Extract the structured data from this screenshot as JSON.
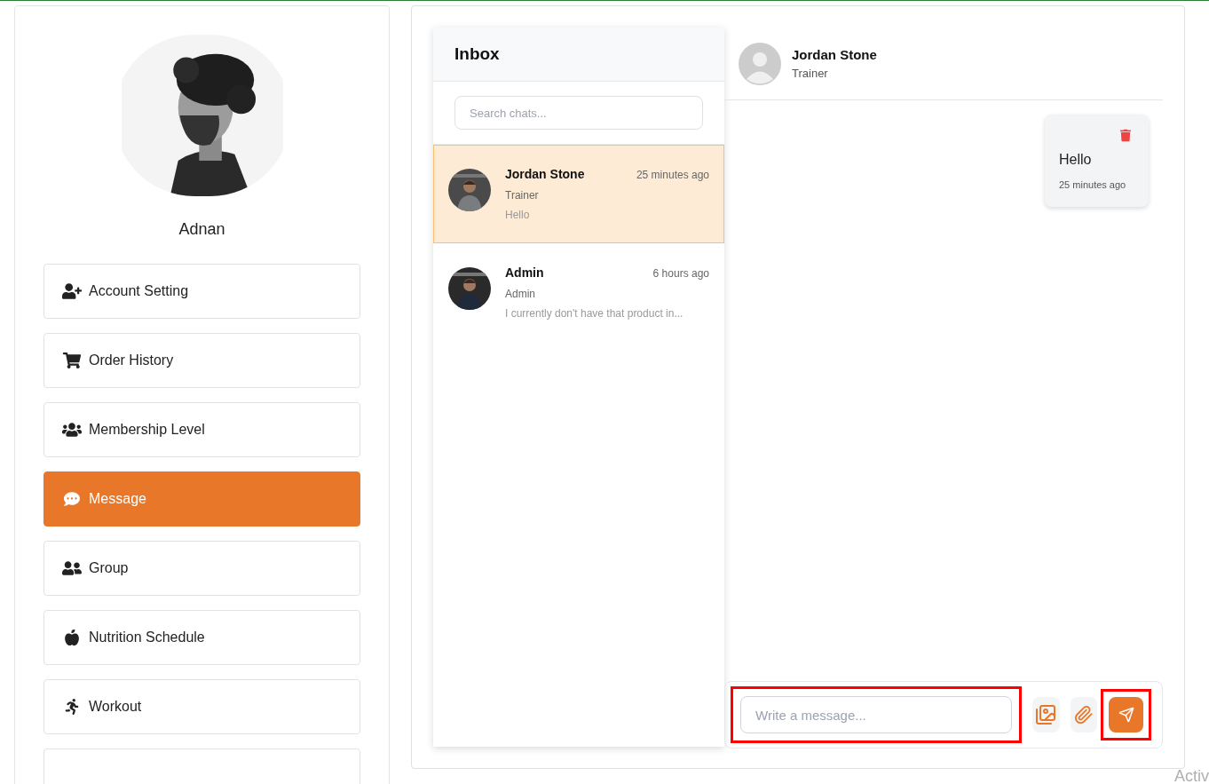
{
  "profile": {
    "name": "Adnan"
  },
  "menu": [
    {
      "label": "Account Setting",
      "selected": false
    },
    {
      "label": "Order History",
      "selected": false
    },
    {
      "label": "Membership Level",
      "selected": false
    },
    {
      "label": "Message",
      "selected": true
    },
    {
      "label": "Group",
      "selected": false
    },
    {
      "label": "Nutrition Schedule",
      "selected": false
    },
    {
      "label": "Workout",
      "selected": false
    }
  ],
  "inbox": {
    "title": "Inbox",
    "search": {
      "placeholder": "Search chats..."
    },
    "chats": [
      {
        "name": "Jordan Stone",
        "role": "Trainer",
        "preview": "Hello",
        "time": "25 minutes ago",
        "selected": true
      },
      {
        "name": "Admin",
        "role": "Admin",
        "preview": "I currently don't have that product in...",
        "time": "6 hours ago",
        "selected": false
      }
    ]
  },
  "chat": {
    "name": "Jordan Stone",
    "role": "Trainer",
    "messages": [
      {
        "text": "Hello",
        "time": "25 minutes ago"
      }
    ],
    "composer": {
      "placeholder": "Write a message...",
      "highlighted": true
    },
    "send_button": {
      "highlighted": true
    }
  },
  "activation_notice": "Activ"
}
